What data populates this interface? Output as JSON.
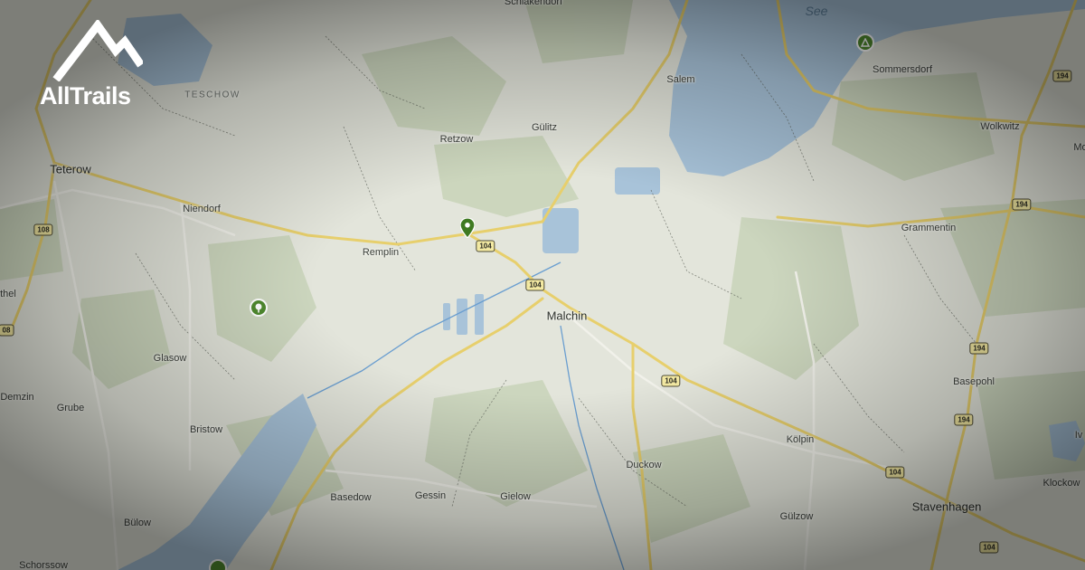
{
  "brand": {
    "logo_text": "AllTrails",
    "logo_icon": "mountain-logo-icon"
  },
  "colors": {
    "land": "#e3e5db",
    "forest": "#c7d3b6",
    "water": "#a8c3d9",
    "road": "#e7cf6c",
    "trail_green": "#4f8a2e"
  },
  "water_labels": [
    {
      "name": "See"
    }
  ],
  "region_labels": [
    {
      "name": "TESCHOW"
    }
  ],
  "places": [
    {
      "name": "Schlakendorf"
    },
    {
      "name": "Sommersdorf"
    },
    {
      "name": "Salem"
    },
    {
      "name": "Gülitz"
    },
    {
      "name": "Retzow"
    },
    {
      "name": "Wolkwitz"
    },
    {
      "name": "Mo"
    },
    {
      "name": "Teterow"
    },
    {
      "name": "Niendorf"
    },
    {
      "name": "Grammentin"
    },
    {
      "name": "Remplin"
    },
    {
      "name": "Malchin"
    },
    {
      "name": "thel"
    },
    {
      "name": "Glasow"
    },
    {
      "name": "Basepohl"
    },
    {
      "name": "Demzin"
    },
    {
      "name": "Grube"
    },
    {
      "name": "Bristow"
    },
    {
      "name": "Kölpin"
    },
    {
      "name": "Iv"
    },
    {
      "name": "Duckow"
    },
    {
      "name": "Klockow"
    },
    {
      "name": "Basedow"
    },
    {
      "name": "Gessin"
    },
    {
      "name": "Gielow"
    },
    {
      "name": "Stavenhagen"
    },
    {
      "name": "Bülow"
    },
    {
      "name": "Gülzow"
    },
    {
      "name": "Schorssow"
    }
  ],
  "road_shields": [
    {
      "label": "194"
    },
    {
      "label": "194"
    },
    {
      "label": "108"
    },
    {
      "label": "104"
    },
    {
      "label": "104"
    },
    {
      "label": "08"
    },
    {
      "label": "194"
    },
    {
      "label": "104"
    },
    {
      "label": "194"
    },
    {
      "label": "104"
    },
    {
      "label": "104"
    }
  ],
  "markers": [
    {
      "type": "campground",
      "icon": "campground-icon"
    },
    {
      "type": "park",
      "icon": "tree-icon"
    },
    {
      "type": "trailhead",
      "icon": "trail-pin-icon"
    },
    {
      "type": "trail",
      "icon": "trail-marker-icon"
    }
  ]
}
